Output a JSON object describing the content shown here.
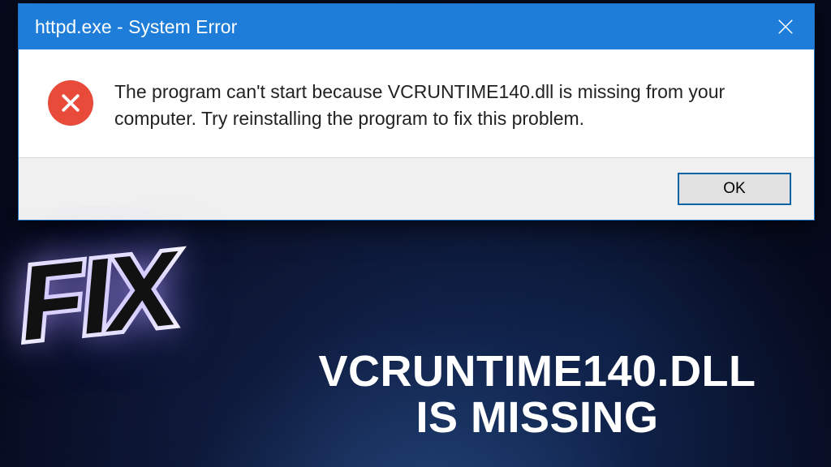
{
  "dialog": {
    "title": "httpd.exe - System Error",
    "message": "The program can't start because VCRUNTIME140.dll is missing from your computer. Try reinstalling the program to fix this problem.",
    "ok_label": "OK"
  },
  "overlay": {
    "badge": "FIX",
    "caption_line1": "VCRUNTIME140.DLL",
    "caption_line2": "IS MISSING"
  },
  "colors": {
    "titlebar": "#1e7dd9",
    "error_icon": "#e84b3a",
    "ok_border": "#0a64a4"
  }
}
